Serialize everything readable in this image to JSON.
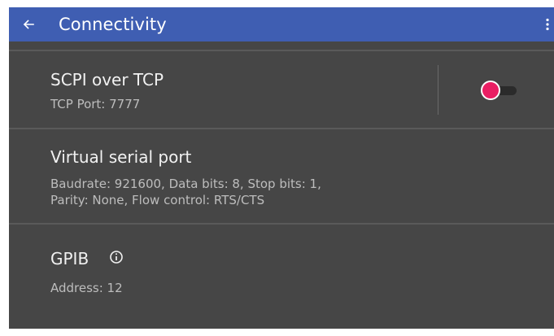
{
  "app_bar": {
    "title": "Connectivity",
    "back_icon": "arrow-left-icon",
    "menu_icon": "more-vert-icon",
    "background_color": "#3f5eb2"
  },
  "settings": {
    "scpi": {
      "title": "SCPI over TCP",
      "subtitle": "TCP Port: 7777",
      "toggle_on": false,
      "toggle_color": "#e91e63"
    },
    "serial": {
      "title": "Virtual serial port",
      "subtitle_line1": "Baudrate: 921600, Data bits: 8, Stop bits: 1,",
      "subtitle_line2": "Parity: None, Flow control: RTS/CTS"
    },
    "gpib": {
      "title": "GPIB",
      "info_icon": "info-icon",
      "subtitle": "Address: 12"
    }
  },
  "colors": {
    "background": "#464646",
    "divider": "#5a5a5a"
  }
}
